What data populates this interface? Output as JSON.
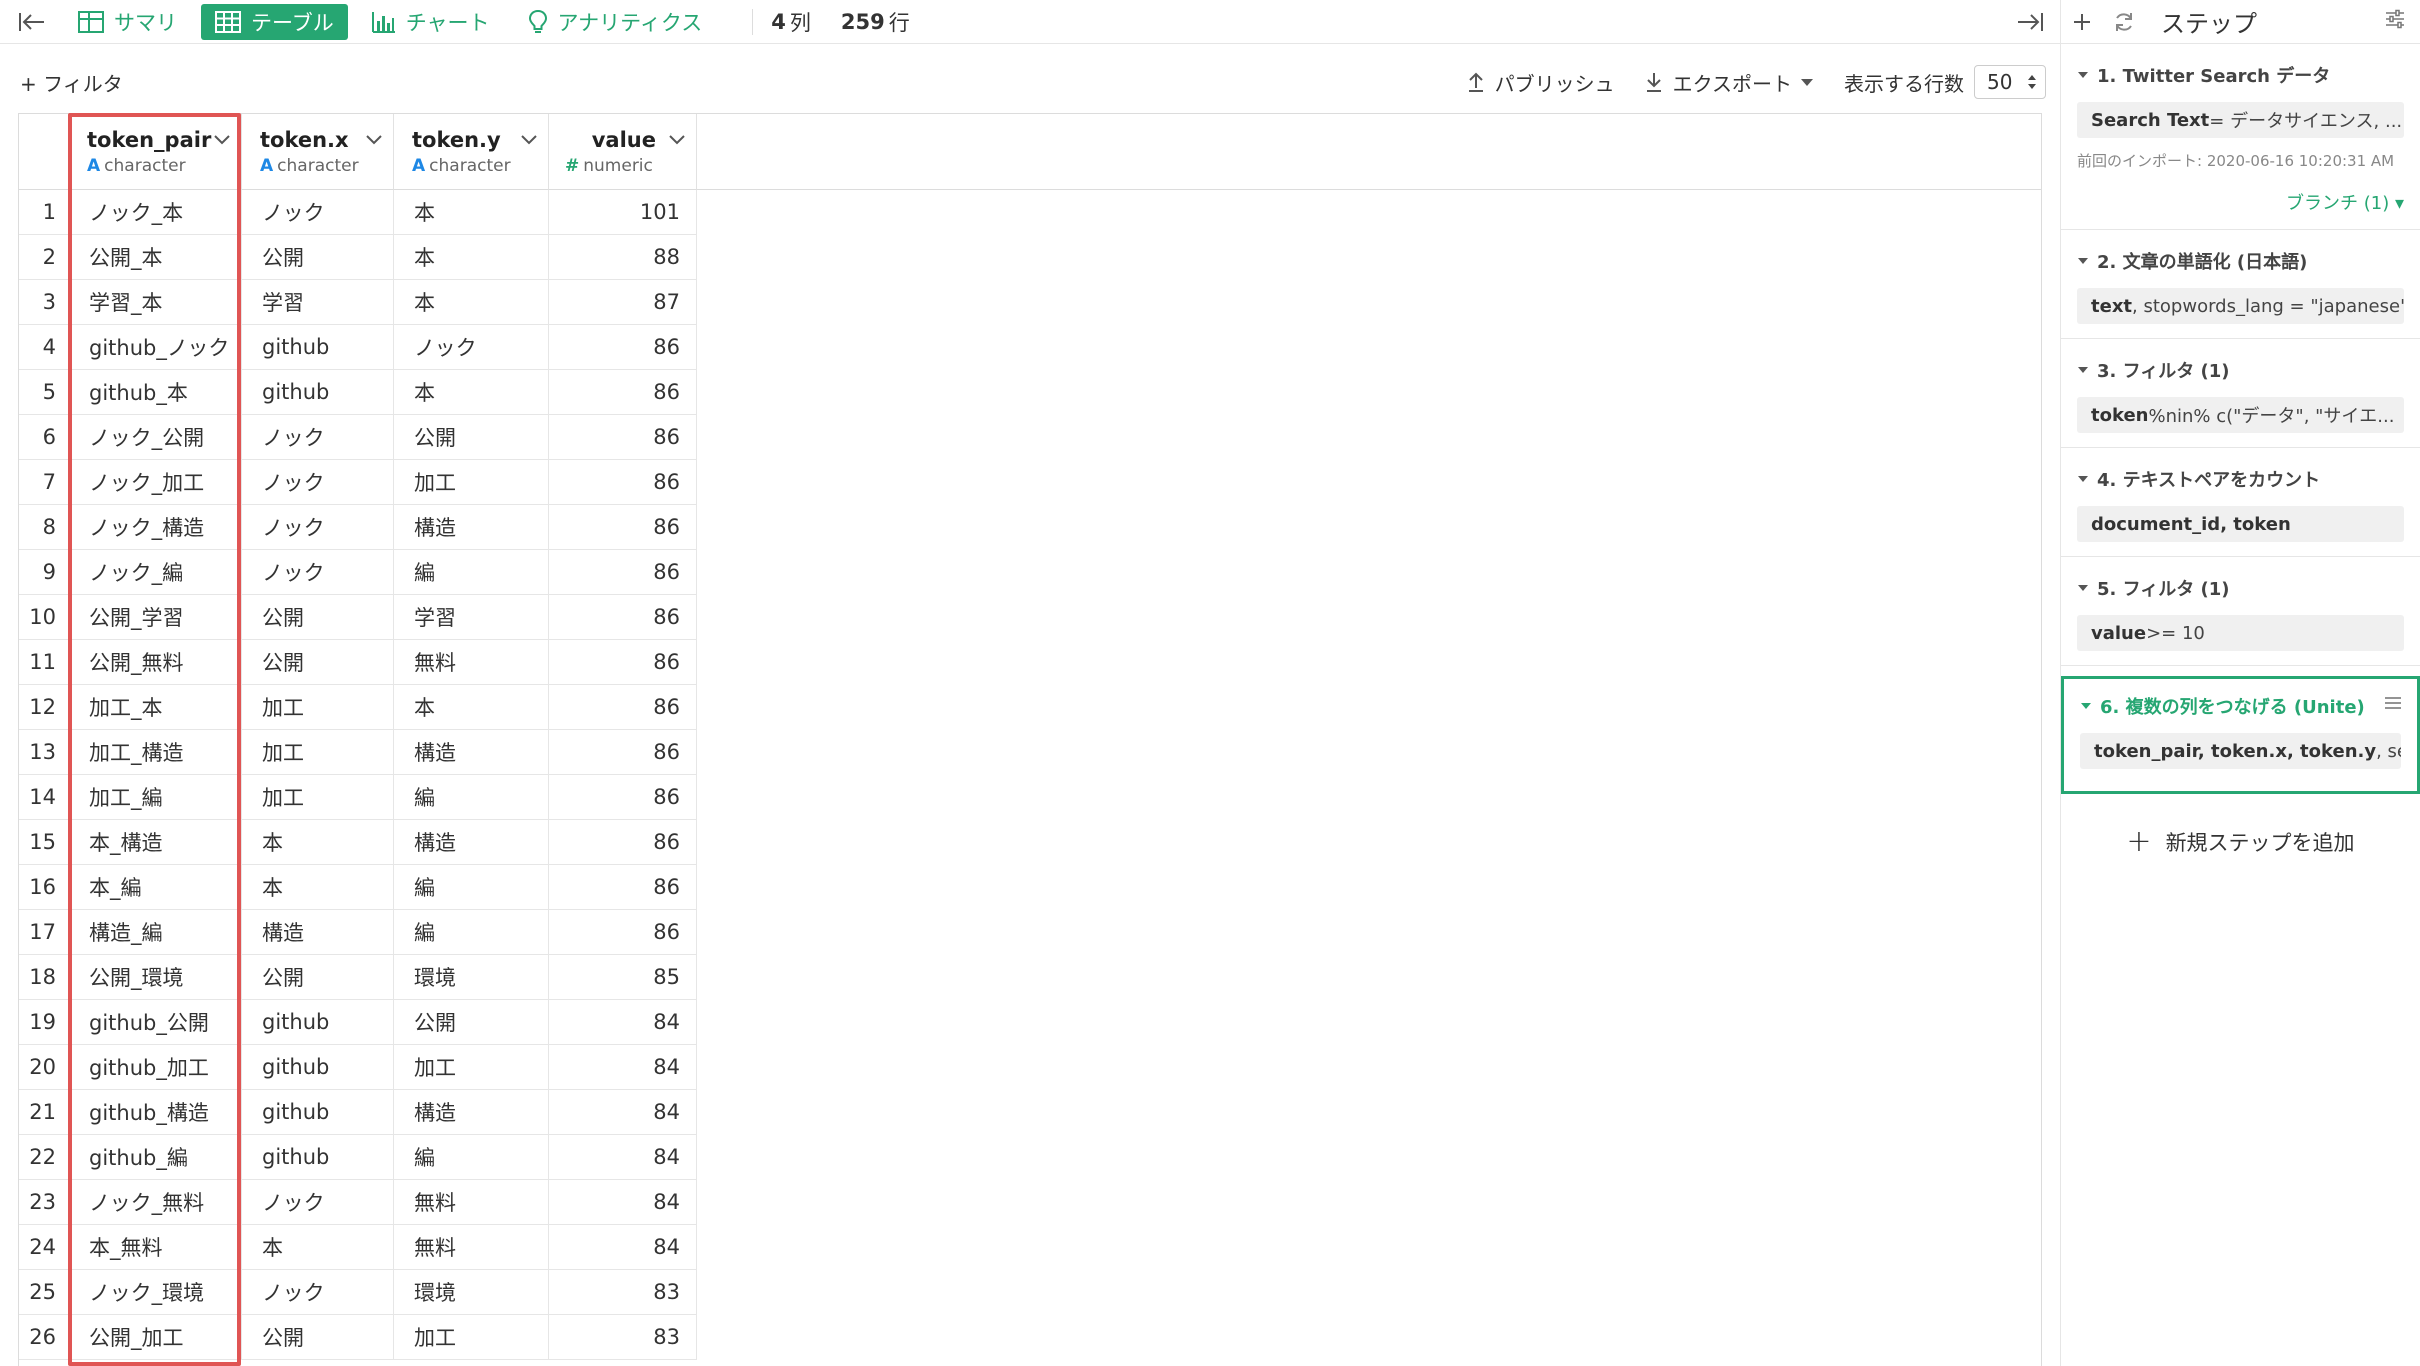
{
  "topbar": {
    "tabs": [
      {
        "label": "サマリ",
        "icon": "summary-grid-icon",
        "active": false
      },
      {
        "label": "テーブル",
        "icon": "table-icon",
        "active": true
      },
      {
        "label": "チャート",
        "icon": "chart-bars-icon",
        "active": false
      },
      {
        "label": "アナリティクス",
        "icon": "lightbulb-icon",
        "active": false
      }
    ],
    "columns_count": "4",
    "columns_unit": "列",
    "rows_count": "259",
    "rows_unit": "行"
  },
  "subbar": {
    "add_filter": "+ フィルタ",
    "publish": "パブリッシュ",
    "export": "エクスポート",
    "rows_label": "表示する行数",
    "rows_value": "50"
  },
  "table": {
    "columns": [
      {
        "name": "token_pair",
        "type_icon": "A",
        "type": "character"
      },
      {
        "name": "token.x",
        "type_icon": "A",
        "type": "character"
      },
      {
        "name": "token.y",
        "type_icon": "A",
        "type": "character"
      },
      {
        "name": "value",
        "type_icon": "#",
        "type": "numeric"
      }
    ],
    "rows": [
      [
        "ノック_本",
        "ノック",
        "本",
        "101"
      ],
      [
        "公開_本",
        "公開",
        "本",
        "88"
      ],
      [
        "学習_本",
        "学習",
        "本",
        "87"
      ],
      [
        "github_ノック",
        "github",
        "ノック",
        "86"
      ],
      [
        "github_本",
        "github",
        "本",
        "86"
      ],
      [
        "ノック_公開",
        "ノック",
        "公開",
        "86"
      ],
      [
        "ノック_加工",
        "ノック",
        "加工",
        "86"
      ],
      [
        "ノック_構造",
        "ノック",
        "構造",
        "86"
      ],
      [
        "ノック_編",
        "ノック",
        "編",
        "86"
      ],
      [
        "公開_学習",
        "公開",
        "学習",
        "86"
      ],
      [
        "公開_無料",
        "公開",
        "無料",
        "86"
      ],
      [
        "加工_本",
        "加工",
        "本",
        "86"
      ],
      [
        "加工_構造",
        "加工",
        "構造",
        "86"
      ],
      [
        "加工_編",
        "加工",
        "編",
        "86"
      ],
      [
        "本_構造",
        "本",
        "構造",
        "86"
      ],
      [
        "本_編",
        "本",
        "編",
        "86"
      ],
      [
        "構造_編",
        "構造",
        "編",
        "86"
      ],
      [
        "公開_環境",
        "公開",
        "環境",
        "85"
      ],
      [
        "github_公開",
        "github",
        "公開",
        "84"
      ],
      [
        "github_加工",
        "github",
        "加工",
        "84"
      ],
      [
        "github_構造",
        "github",
        "構造",
        "84"
      ],
      [
        "github_編",
        "github",
        "編",
        "84"
      ],
      [
        "ノック_無料",
        "ノック",
        "無料",
        "84"
      ],
      [
        "本_無料",
        "本",
        "無料",
        "84"
      ],
      [
        "ノック_環境",
        "ノック",
        "環境",
        "83"
      ],
      [
        "公開_加工",
        "公開",
        "加工",
        "83"
      ]
    ],
    "highlight_color": "#e05554"
  },
  "panel": {
    "title": "ステップ",
    "steps": [
      {
        "title": "1. Twitter Search データ",
        "box_bold": "Search Text",
        "box_rest": " = データサイエンス, ...",
        "meta": "前回のインポート: 2020-06-16 10:20:31 AM",
        "branch": "ブランチ (1) ▾"
      },
      {
        "title": "2. 文章の単語化 (日本語)",
        "box_bold": "text",
        "box_rest": ", stopwords_lang = \"japanese\""
      },
      {
        "title": "3. フィルタ (1)",
        "box_bold": "token",
        "box_rest": " %nin% c(\"データ\", \"サイエ..."
      },
      {
        "title": "4. テキストペアをカウント",
        "box_bold": "document_id",
        "box_rest": ", token",
        "box_rest_bold": true
      },
      {
        "title": "5. フィルタ (1)",
        "box_bold": "value",
        "box_rest": " >= 10"
      },
      {
        "title": "6. 複数の列をつなげる (Unite)",
        "box_bold": "token_pair, token.x, token.y",
        "box_rest": ", sep ...",
        "active": true
      }
    ],
    "add_step": "新規ステップを追加"
  },
  "colors": {
    "accent": "#26a672",
    "char_type": "#1e88e5",
    "highlight": "#e05554"
  }
}
